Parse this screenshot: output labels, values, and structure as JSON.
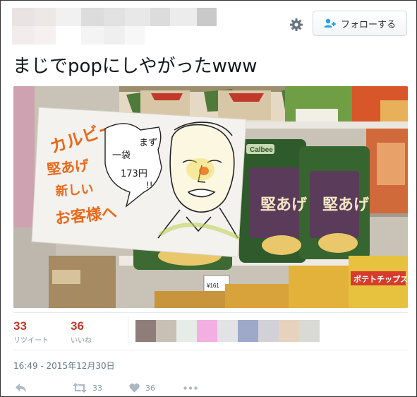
{
  "header": {
    "follow_label": "フォローする",
    "icons": [
      "gear-icon",
      "add-person-icon"
    ]
  },
  "tweet": {
    "text": "まじでpopにしやがったwww",
    "timestamp": "16:49 - 2015年12月30日"
  },
  "photo": {
    "sign_lines": [
      "カルビー",
      "堅あげ",
      "新しい",
      "お客様へ"
    ],
    "speech": [
      "まず",
      "一袋",
      "173円",
      "!!"
    ],
    "bag_brand": "Calbee",
    "bag_title": "堅あげ",
    "price_tag": "¥161",
    "lower_bag_text": "ポテトチップス"
  },
  "stats": {
    "retweets": {
      "count": "33",
      "label": "リツイート"
    },
    "likes": {
      "count": "36",
      "label": "いいね"
    }
  },
  "actions": {
    "retweet_count": "33",
    "like_count": "36",
    "icons": [
      "reply-icon",
      "retweet-icon",
      "heart-icon",
      "more-icon"
    ]
  },
  "colors": {
    "count_red": "#c0392b",
    "muted": "#8899a6",
    "separator": "#e6ecf0"
  }
}
